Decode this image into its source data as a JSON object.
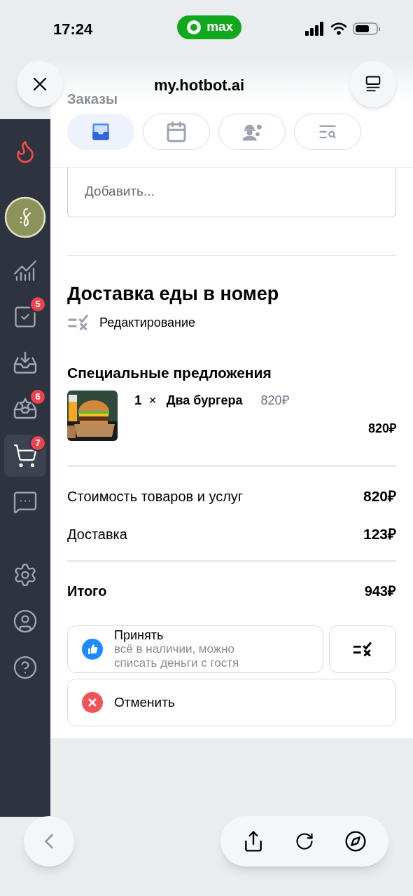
{
  "status_bar": {
    "time": "17:24",
    "app_pill": "max"
  },
  "browser": {
    "url": "my.hotbot.ai"
  },
  "page_title": "Заказы",
  "tabs": [
    {
      "selected": true
    },
    {
      "selected": false
    },
    {
      "selected": false
    },
    {
      "selected": false
    }
  ],
  "sidebar": {
    "items": [
      {
        "selected": false
      },
      {
        "selected": false,
        "badge": "5"
      },
      {
        "selected": false
      },
      {
        "selected": false,
        "badge": "6"
      },
      {
        "selected": true,
        "badge": "7"
      },
      {
        "selected": false
      }
    ],
    "bottom_items": [
      {
        "selected": false
      },
      {
        "selected": false
      },
      {
        "selected": false
      }
    ]
  },
  "comment_field": {
    "placeholder": "Добавить..."
  },
  "order": {
    "title": "Доставка еды в номер",
    "status": "Редактирование",
    "section": "Специальные предложения",
    "items": [
      {
        "qty": "1",
        "times": "×",
        "name": "Два бургера",
        "unit_price": "820₽",
        "total": "820₽"
      }
    ],
    "summary": [
      {
        "label": "Стоимость товаров и услуг",
        "value": "820₽"
      },
      {
        "label": "Доставка",
        "value": "123₽"
      }
    ],
    "total": {
      "label": "Итого",
      "value": "943₽"
    },
    "accept": {
      "label": "Принять",
      "hint": "всё в наличии, можно списать деньги с гостя"
    },
    "cancel": {
      "label": "Отменить"
    }
  }
}
